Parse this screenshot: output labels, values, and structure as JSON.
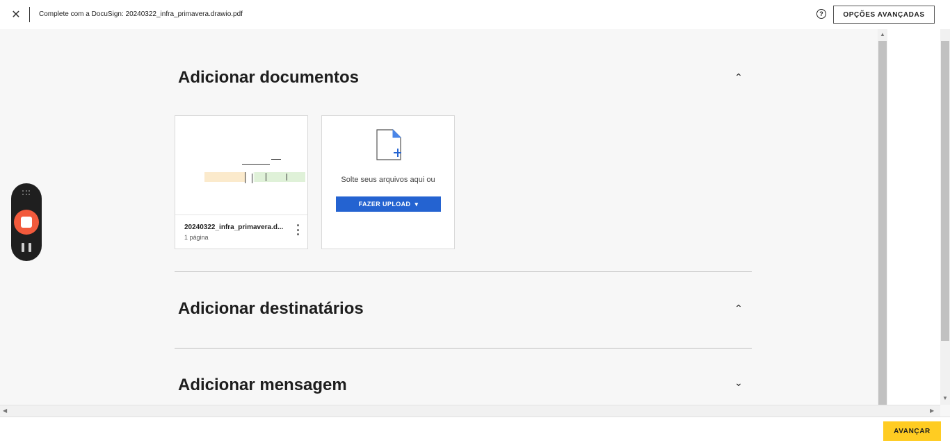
{
  "header": {
    "close_symbol": "✕",
    "title": "Complete com a DocuSign: 20240322_infra_primavera.drawio.pdf",
    "help_symbol": "?",
    "advanced_options_label": "OPÇÕES AVANÇADAS"
  },
  "sections": {
    "documents": {
      "title": "Adicionar documentos",
      "expanded": true
    },
    "recipients": {
      "title": "Adicionar destinatários",
      "expanded": true
    },
    "message": {
      "title": "Adicionar mensagem",
      "expanded": false
    }
  },
  "chevrons": {
    "up": "⌃",
    "down": "⌄"
  },
  "document_card": {
    "file_name": "20240322_infra_primavera.d...",
    "pages": "1 página"
  },
  "upload_card": {
    "drop_text": "Solte seus arquivos aqui ou",
    "upload_label": "FAZER UPLOAD",
    "dropdown_symbol": "▾"
  },
  "footer": {
    "next_label": "AVANÇAR"
  },
  "colors": {
    "accent_blue": "#2463d1",
    "next_yellow": "#ffcc22",
    "record_red": "#f25a3c"
  }
}
